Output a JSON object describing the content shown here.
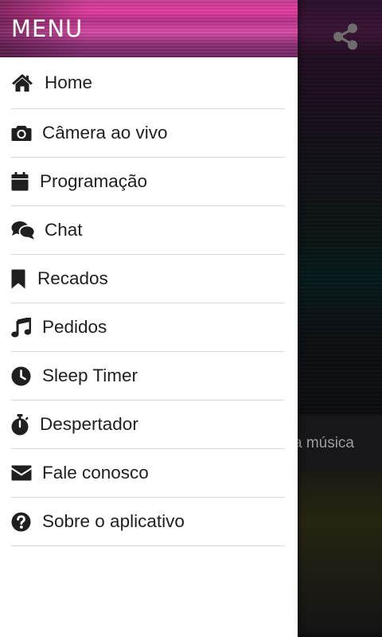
{
  "background": {
    "now_playing_fragment": "a música",
    "share_icon": "share-icon"
  },
  "drawer": {
    "title": "MENU",
    "items": [
      {
        "label": "Home",
        "icon": "home-icon"
      },
      {
        "label": "Câmera ao vivo",
        "icon": "camera-icon"
      },
      {
        "label": "Programação",
        "icon": "calendar-icon"
      },
      {
        "label": "Chat",
        "icon": "chat-icon"
      },
      {
        "label": "Recados",
        "icon": "bookmark-icon"
      },
      {
        "label": "Pedidos",
        "icon": "music-icon"
      },
      {
        "label": "Sleep Timer",
        "icon": "clock-icon"
      },
      {
        "label": "Despertador",
        "icon": "stopwatch-icon"
      },
      {
        "label": "Fale conosco",
        "icon": "envelope-icon"
      },
      {
        "label": "Sobre o aplicativo",
        "icon": "question-circle-icon"
      }
    ]
  },
  "colors": {
    "header_accent": "#d63ca0",
    "menu_text": "#1f1f1f",
    "divider": "#d9d9d9"
  }
}
